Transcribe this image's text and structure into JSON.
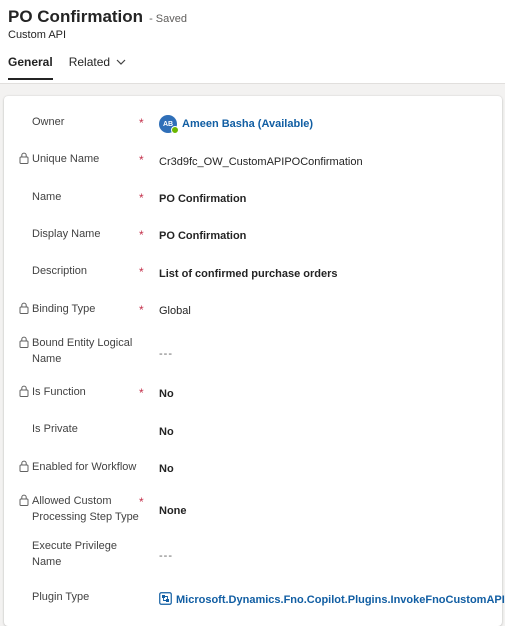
{
  "header": {
    "title": "PO Confirmation",
    "saved_status": "- Saved",
    "entity_type": "Custom API",
    "tabs": [
      {
        "label": "General",
        "active": true
      },
      {
        "label": "Related",
        "active": false
      }
    ]
  },
  "form": {
    "owner": {
      "label": "Owner",
      "value": "Ameen Basha (Available)",
      "avatar_initials": "AB",
      "required": "*"
    },
    "unique_name": {
      "label": "Unique Name",
      "value": "Cr3d9fc_OW_CustomAPIPOConfirmation",
      "required": "*"
    },
    "name": {
      "label": "Name",
      "value": "PO Confirmation",
      "required": "*"
    },
    "display_name": {
      "label": "Display Name",
      "value": "PO Confirmation",
      "required": "*"
    },
    "description": {
      "label": "Description",
      "value": "List of confirmed purchase orders",
      "required": "*"
    },
    "binding_type": {
      "label": "Binding Type",
      "value": "Global",
      "required": "*"
    },
    "bound_entity_logical_name": {
      "label": "Bound Entity Logical Name",
      "value": "---"
    },
    "is_function": {
      "label": "Is Function",
      "value": "No",
      "required": "*"
    },
    "is_private": {
      "label": "Is Private",
      "value": "No"
    },
    "enabled_for_workflow": {
      "label": "Enabled for Workflow",
      "value": "No"
    },
    "allowed_custom_processing_step_type": {
      "label": "Allowed Custom Processing Step Type",
      "value": "None",
      "required": "*"
    },
    "execute_privilege_name": {
      "label": "Execute Privilege Name",
      "value": "---"
    },
    "plugin_type": {
      "label": "Plugin Type",
      "value": "Microsoft.Dynamics.Fno.Copilot.Plugins.InvokeFnoCustomAPI"
    }
  },
  "colors": {
    "accent_link": "#115ea3",
    "required": "#c4314b",
    "presence": "#6bb700",
    "avatar": "#2f6fb8"
  }
}
